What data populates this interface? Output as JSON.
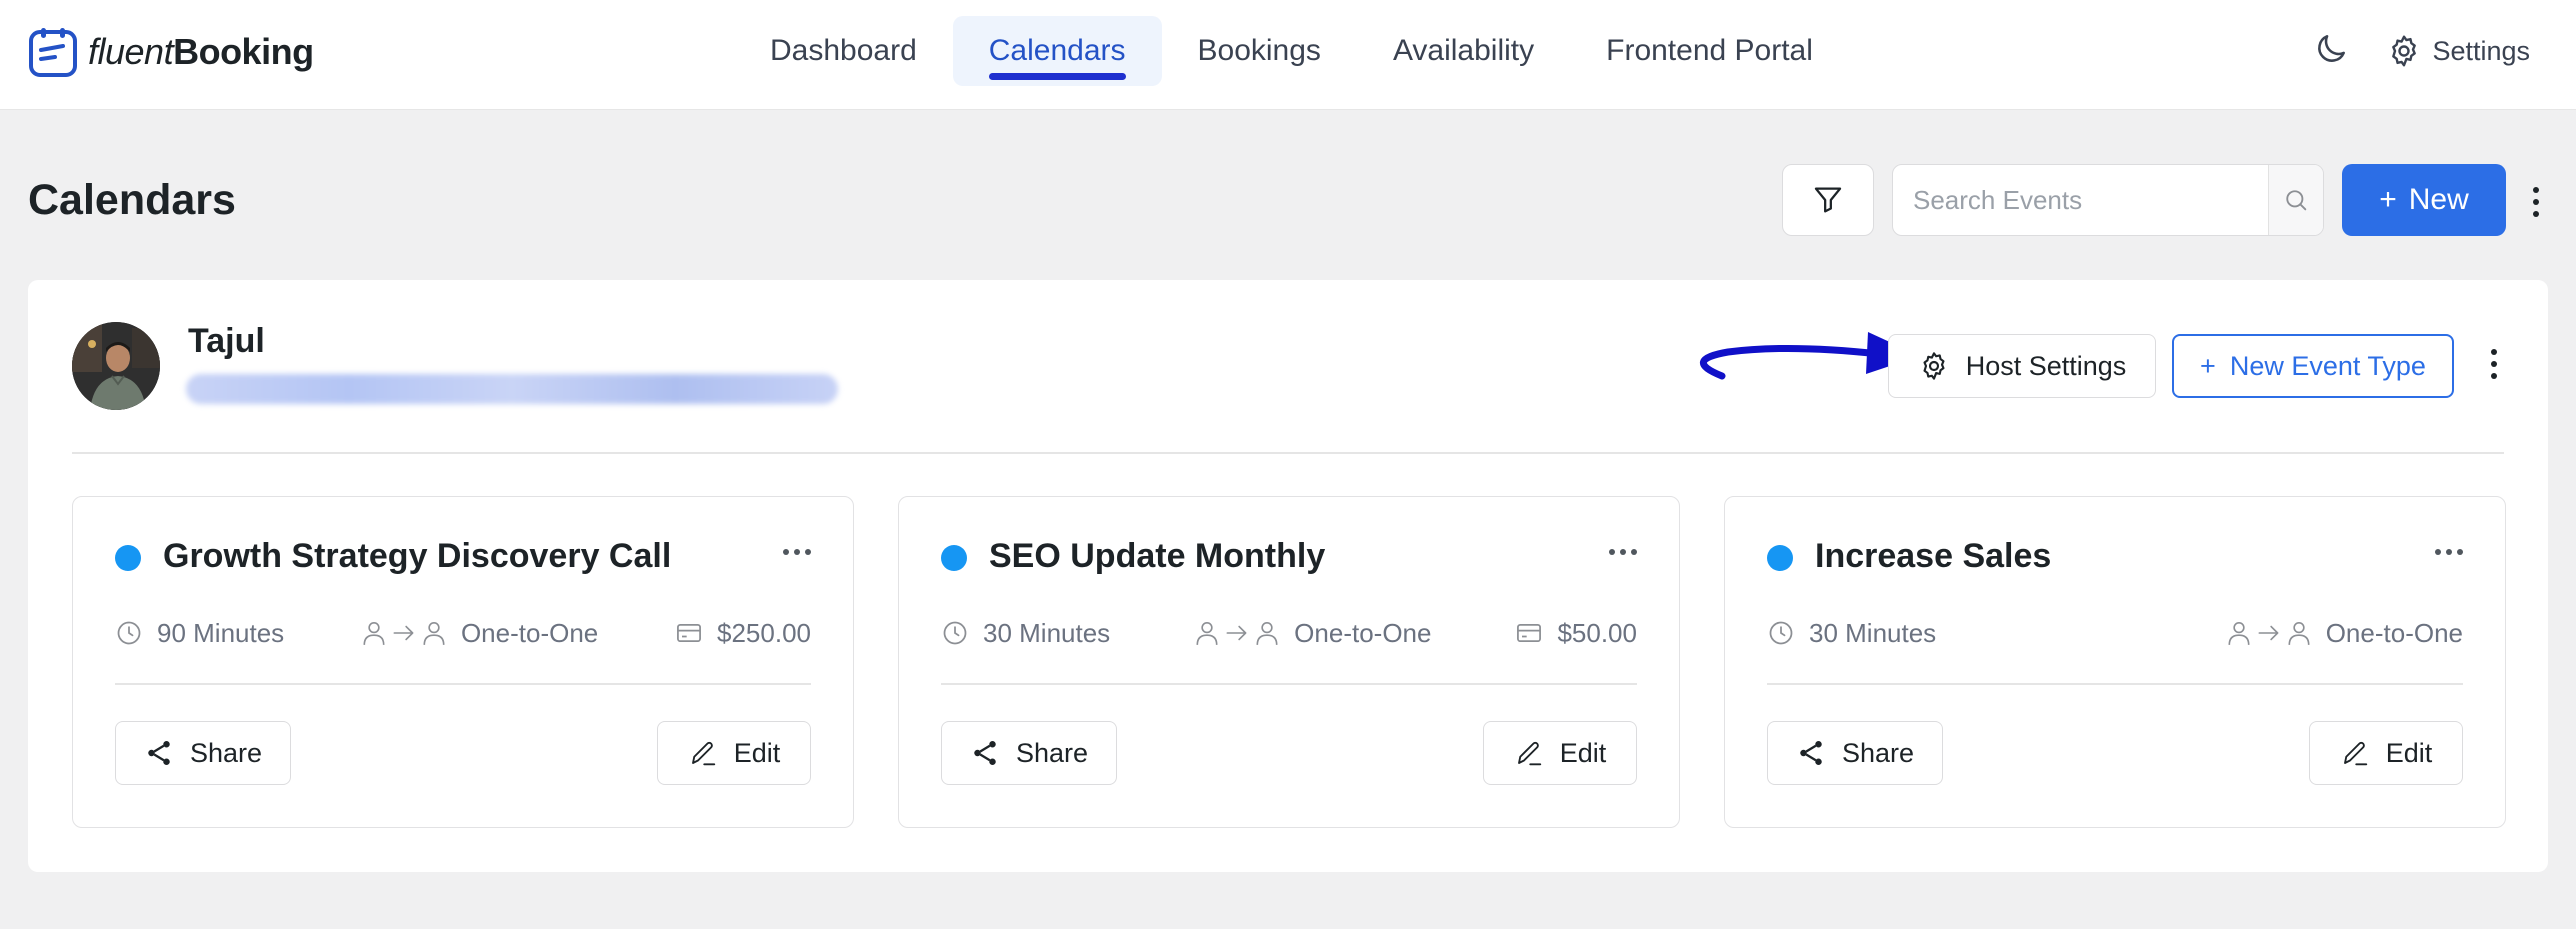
{
  "brand": {
    "name_light": "fluent",
    "name_bold": "Booking"
  },
  "nav": {
    "items": [
      {
        "label": "Dashboard"
      },
      {
        "label": "Calendars"
      },
      {
        "label": "Bookings"
      },
      {
        "label": "Availability"
      },
      {
        "label": "Frontend Portal"
      }
    ],
    "active": "Calendars",
    "settings_label": "Settings"
  },
  "page": {
    "title": "Calendars",
    "search_placeholder": "Search Events",
    "new_button": "New",
    "new_button_plus": "+"
  },
  "host": {
    "name": "Tajul",
    "host_settings_label": "Host Settings",
    "new_event_type_label": "New Event Type",
    "new_event_type_plus": "+"
  },
  "events": [
    {
      "title": "Growth Strategy Discovery Call",
      "duration": "90 Minutes",
      "type": "One-to-One",
      "price": "$250.00",
      "share_label": "Share",
      "edit_label": "Edit",
      "color": "#1696f3"
    },
    {
      "title": "SEO Update Monthly",
      "duration": "30 Minutes",
      "type": "One-to-One",
      "price": "$50.00",
      "share_label": "Share",
      "edit_label": "Edit",
      "color": "#1696f3"
    },
    {
      "title": "Increase Sales",
      "duration": "30 Minutes",
      "type": "One-to-One",
      "price": null,
      "share_label": "Share",
      "edit_label": "Edit",
      "color": "#1696f3"
    }
  ],
  "colors": {
    "primary": "#2c6ee6",
    "nav_active": "#2452c6",
    "annotation_arrow": "#1010c8",
    "event_dot": "#1696f3"
  },
  "icons": [
    "logo-icon",
    "moon-icon",
    "gear-icon",
    "filter-icon",
    "search-icon",
    "plus-icon",
    "kebab-icon",
    "clock-icon",
    "user-arrow-user-icon",
    "credit-card-icon",
    "share-icon",
    "edit-icon",
    "more-horizontal-icon",
    "annotation-arrow"
  ]
}
